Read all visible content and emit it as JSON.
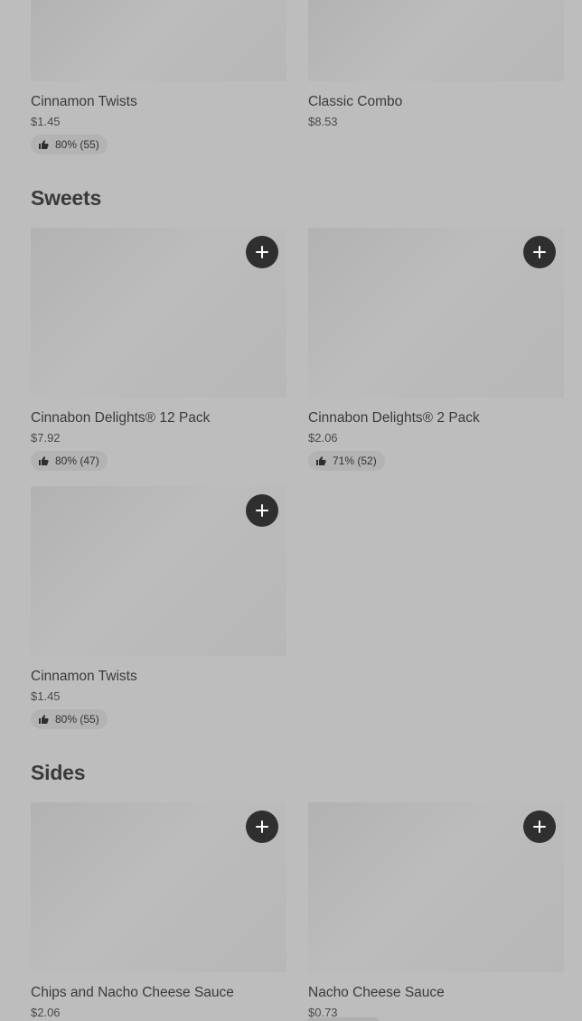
{
  "top_row": [
    {
      "name": "Cinnamon Twists",
      "price": "$1.45",
      "rating": "80% (55)"
    },
    {
      "name": "Classic Combo",
      "price": "$8.53"
    }
  ],
  "sweets": {
    "title": "Sweets",
    "items": [
      {
        "name": "Cinnabon Delights® 12 Pack",
        "price": "$7.92",
        "rating": "80% (47)"
      },
      {
        "name": "Cinnabon Delights® 2 Pack",
        "price": "$2.06",
        "rating": "71% (52)"
      },
      {
        "name": "Cinnamon Twists",
        "price": "$1.45",
        "rating": "80% (55)"
      }
    ]
  },
  "sides": {
    "title": "Sides",
    "items": [
      {
        "name": "Chips and Nacho Cheese Sauce",
        "price": "$2.06"
      },
      {
        "name": "Nacho Cheese Sauce",
        "price": "$0.73"
      }
    ]
  },
  "icons": {
    "add": "plus-icon",
    "rating": "thumbs-up-icon"
  },
  "colors": {
    "background": "#bdbdbd",
    "add_button": "#2f2f2f",
    "rating_pill": "#b3b3b3"
  }
}
